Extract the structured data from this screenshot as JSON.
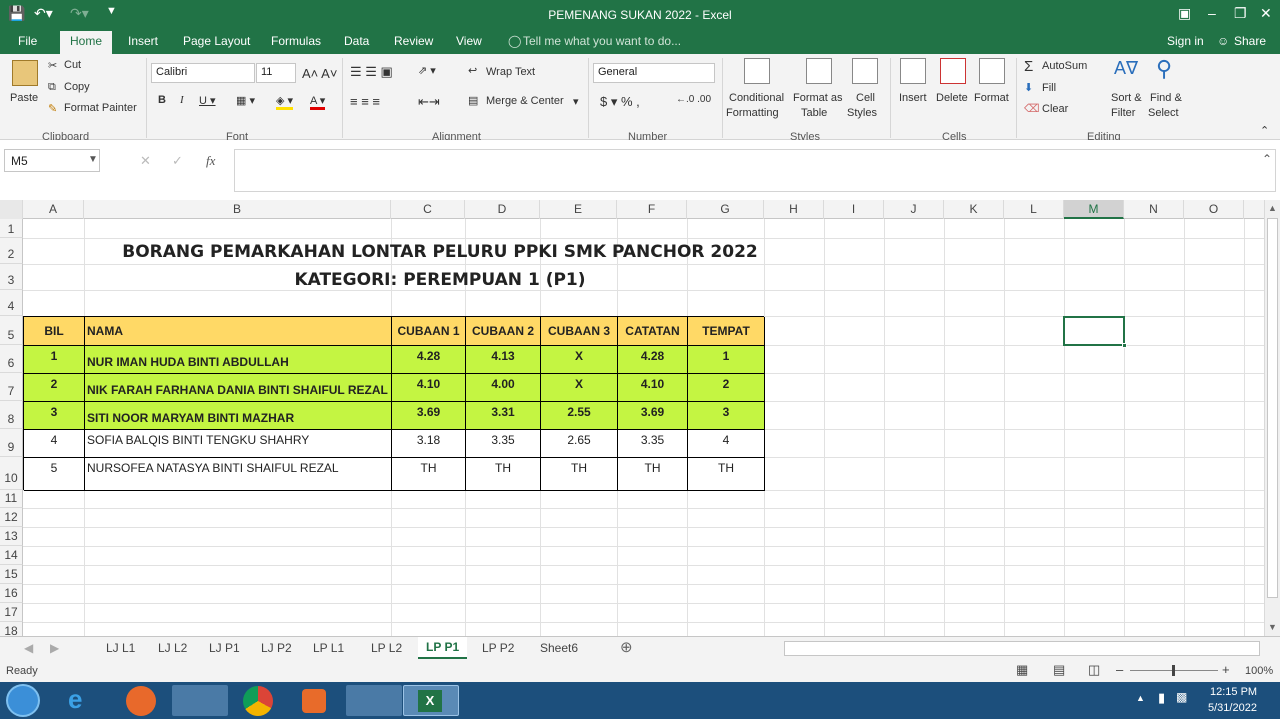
{
  "window": {
    "title": "PEMENANG SUKAN 2022 - Excel"
  },
  "ribbon_tabs": [
    "File",
    "Home",
    "Insert",
    "Page Layout",
    "Formulas",
    "Data",
    "Review",
    "View"
  ],
  "active_tab": "Home",
  "tell_me": "Tell me what you want to do...",
  "signin": "Sign in",
  "share": "Share",
  "clipboard": {
    "paste": "Paste",
    "cut": "Cut",
    "copy": "Copy",
    "format_painter": "Format Painter",
    "group": "Clipboard"
  },
  "font": {
    "name": "Calibri",
    "size": "11",
    "group": "Font"
  },
  "alignment": {
    "wrap": "Wrap Text",
    "merge": "Merge & Center",
    "group": "Alignment"
  },
  "number": {
    "format": "General",
    "group": "Number"
  },
  "styles": {
    "conditional": "Conditional",
    "formatting": "Formatting",
    "format_as": "Format as",
    "table": "Table",
    "cell": "Cell",
    "cell_styles": "Styles",
    "group": "Styles"
  },
  "cells": {
    "insert": "Insert",
    "delete": "Delete",
    "format": "Format",
    "group": "Cells"
  },
  "editing": {
    "autosum": "AutoSum",
    "fill": "Fill",
    "clear": "Clear",
    "sort": "Sort &",
    "filter": "Filter",
    "find": "Find &",
    "select": "Select",
    "group": "Editing"
  },
  "namebox": "M5",
  "fx": "fx",
  "columns": [
    "A",
    "B",
    "C",
    "D",
    "E",
    "F",
    "G",
    "H",
    "I",
    "J",
    "K",
    "L",
    "M",
    "N",
    "O"
  ],
  "selected_column": "M",
  "rows": [
    "1",
    "2",
    "3",
    "4",
    "5",
    "6",
    "7",
    "8",
    "9",
    "10",
    "11",
    "12",
    "13",
    "14",
    "15",
    "16",
    "17",
    "18"
  ],
  "sheet": {
    "title1": "BORANG PEMARKAHAN LONTAR PELURU PPKI SMK PANCHOR 2022",
    "title2": "KATEGORI: PEREMPUAN 1 (P1)",
    "headers": [
      "BIL",
      "NAMA",
      "CUBAAN 1",
      "CUBAAN 2",
      "CUBAAN 3",
      "CATATAN",
      "TEMPAT"
    ],
    "records": [
      [
        "1",
        "NUR IMAN HUDA BINTI ABDULLAH",
        "4.28",
        "4.13",
        "X",
        "4.28",
        "1"
      ],
      [
        "2",
        "NIK FARAH FARHANA DANIA BINTI SHAIFUL REZAL",
        "4.10",
        "4.00",
        "X",
        "4.10",
        "2"
      ],
      [
        "3",
        "SITI NOOR MARYAM BINTI MAZHAR",
        "3.69",
        "3.31",
        "2.55",
        "3.69",
        "3"
      ],
      [
        "4",
        "SOFIA BALQIS BINTI TENGKU SHAHRY",
        "3.18",
        "3.35",
        "2.65",
        "3.35",
        "4"
      ],
      [
        "5",
        "NURSOFEA NATASYA BINTI SHAIFUL REZAL",
        "TH",
        "TH",
        "TH",
        "TH",
        "TH"
      ]
    ]
  },
  "sheet_tabs": [
    "LJ L1",
    "LJ L2",
    "LJ P1",
    "LJ P2",
    "LP L1",
    "LP L2",
    "LP P1",
    "LP P2",
    "Sheet6"
  ],
  "active_sheet": "LP P1",
  "status": "Ready",
  "zoom": "100%",
  "clock": {
    "time": "12:15 PM",
    "date": "5/31/2022"
  },
  "colors": {
    "excel_green": "#217346",
    "header_fill": "#ffd966",
    "winner_fill": "#c4f542"
  }
}
